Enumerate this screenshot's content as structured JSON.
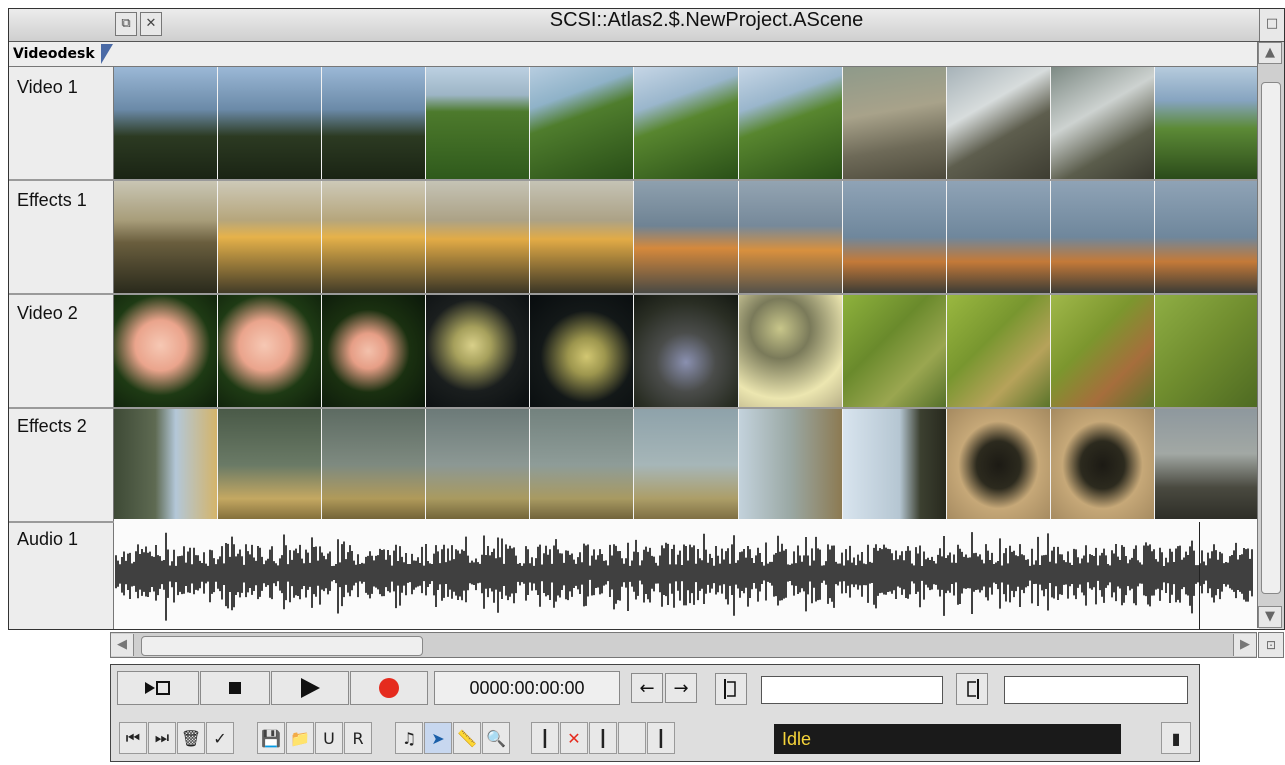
{
  "window": {
    "title": "SCSI::Atlas2.$.NewProject.AScene",
    "toolbar_tab": "Videodesk"
  },
  "tracks": [
    {
      "label": "Video 1",
      "type": "video"
    },
    {
      "label": "Effects 1",
      "type": "effects"
    },
    {
      "label": "Video 2",
      "type": "video"
    },
    {
      "label": "Effects 2",
      "type": "effects"
    },
    {
      "label": "Audio 1",
      "type": "audio"
    }
  ],
  "controls": {
    "timecode": "0000:00:00:00",
    "status": "Idle",
    "in_point_value": "",
    "out_point_value": ""
  },
  "colors": {
    "status_bg": "#1a1a1a",
    "status_text": "#f6d43a",
    "record": "#e52b1e",
    "accent": "#4a6aa6"
  }
}
